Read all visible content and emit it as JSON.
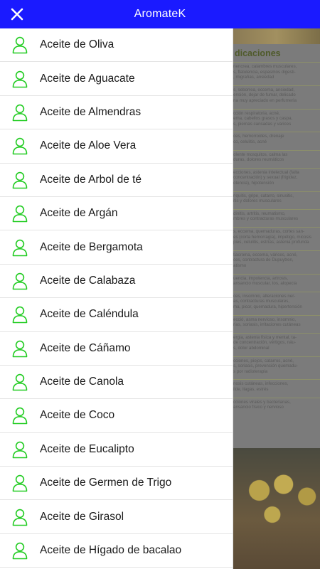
{
  "appbar": {
    "title": "AromateK",
    "close_icon": "close-icon"
  },
  "drawer": {
    "items": [
      {
        "label": "Aceite de Oliva",
        "icon": "user-outline-icon"
      },
      {
        "label": "Aceite de Aguacate",
        "icon": "user-outline-icon"
      },
      {
        "label": "Aceite de Almendras",
        "icon": "user-outline-icon"
      },
      {
        "label": "Aceite de Aloe Vera",
        "icon": "user-outline-icon"
      },
      {
        "label": "Aceite de Arbol de té",
        "icon": "user-outline-icon"
      },
      {
        "label": "Aceite de Argán",
        "icon": "user-outline-icon"
      },
      {
        "label": "Aceite de Bergamota",
        "icon": "user-outline-icon"
      },
      {
        "label": "Aceite de Calabaza",
        "icon": "user-outline-icon"
      },
      {
        "label": "Aceite de Caléndula",
        "icon": "user-outline-icon"
      },
      {
        "label": "Aceite de Cáñamo",
        "icon": "user-outline-icon"
      },
      {
        "label": "Aceite de Canola",
        "icon": "user-outline-icon"
      },
      {
        "label": "Aceite de Coco",
        "icon": "user-outline-icon"
      },
      {
        "label": "Aceite de Eucalipto",
        "icon": "user-outline-icon"
      },
      {
        "label": "Aceite de Germen de Trigo",
        "icon": "user-outline-icon"
      },
      {
        "label": "Aceite de Girasol",
        "icon": "user-outline-icon"
      },
      {
        "label": "Aceite de Hígado de bacalao",
        "icon": "user-outline-icon"
      }
    ]
  },
  "background": {
    "heading": "dicaciones",
    "lines": [
      "nencrea, calambres musculares,",
      "s, flatulencia, espasmos digesti-",
      ", migrañas, ansiedad",
      "s, seborrea, eccema, ansiedad,",
      "ensión, dejar de fumar, delicado",
      "na muy apreciado en perfumeria",
      "cción respiratoria, acné,",
      "ema, cabellos grasos y caspa,",
      "s, piernas cansadas y varices",
      "ces, hemorroides, drenaje",
      "co, celulitis, acné",
      "olente mosquitos, calma las",
      "duras, dolores reumáticos",
      "ecciones, astenia intelectual (falta",
      "concentración) y sexual (frigidez,",
      "otencia), hipotensión",
      "nquitis, gripe, catarro, sinusitis,",
      "itis y dolores musculares",
      "dinitis, artritis, reumatismo,",
      "mbres y contracturas musculares",
      "s, eccema, quemaduras, cortes san-",
      "es (corta hemorragia), impétigo, micosis",
      "pies, celulitis, estrías, astenia profunda",
      "tiacroma, eccema, várices, acné,",
      "ces, contractura de Dupuytren,",
      "atismo",
      "uencia, impotencia, artrosis,",
      "ansancio muscular, tos, alopecia",
      "ces, insomnio, alteraciones ner-",
      "as, contracturas musculares,",
      "ma, picor, quemadura, hipertensión",
      "ecció, asma nervioso, insomnio,",
      "rias, soriasis, irritaciones cutáneas",
      "ergia, astenia física y mental, ta-",
      "de concentración, vértigos, náu-",
      "s, dolor abdominal",
      "cciones, piojos, catarros, acné,",
      "s, soriasis, prevención quemadu-",
      "s por radioterapia",
      "nosis cutáneas, infecciones,",
      "ilde, llagas, estrés",
      "cciones virales y bacterianas,",
      "ansancio físico y nervioso"
    ]
  }
}
